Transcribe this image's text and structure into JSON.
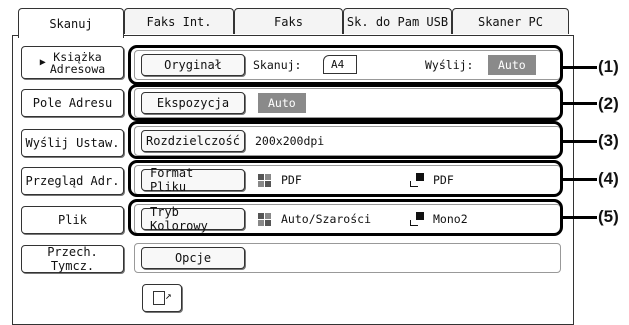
{
  "tabs": [
    "Skanuj",
    "Faks Int.",
    "Faks",
    "Sk. do Pam USB",
    "Skaner PC"
  ],
  "left_buttons": {
    "book": "Książka\nAdresowa",
    "address": "Pole Adresu",
    "send_settings": "Wyślij Ustaw.",
    "review": "Przegląd Adr.",
    "file": "Plik",
    "temp_store": "Przech. Tymcz."
  },
  "settings": {
    "original": {
      "label": "Oryginał",
      "scan_label": "Skanuj:",
      "scan_size": "A4",
      "send_label": "Wyślij:",
      "send_value": "Auto"
    },
    "exposure": {
      "label": "Ekspozycja",
      "value": "Auto"
    },
    "resolution": {
      "label": "Rozdzielczość",
      "value": "200x200dpi"
    },
    "file_format": {
      "label": "Format Pliku",
      "color_value": "PDF",
      "mono_value": "PDF"
    },
    "color_mode": {
      "label": "Tryb Kolorowy",
      "color_value": "Auto/Szarości",
      "mono_value": "Mono2"
    },
    "options": {
      "label": "Opcje"
    }
  },
  "callouts": [
    "(1)",
    "(2)",
    "(3)",
    "(4)",
    "(5)"
  ],
  "colors": {
    "badge": "#8a8a8a",
    "border": "#333333"
  },
  "icons": {
    "book": "triangle-right-icon",
    "bottom": "edit-icon"
  }
}
